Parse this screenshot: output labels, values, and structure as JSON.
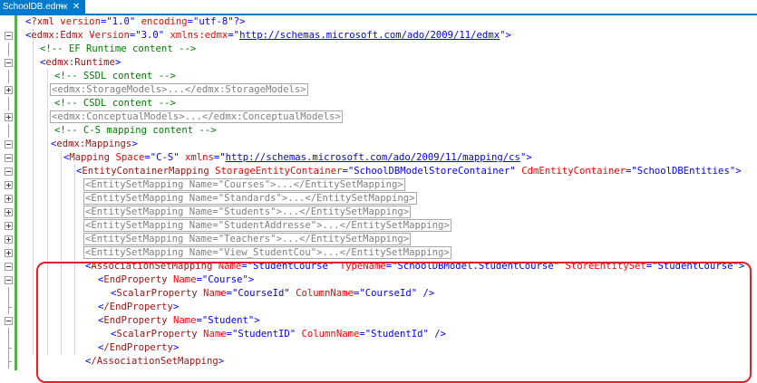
{
  "tab": {
    "label": "SchoolDB.edmx",
    "pin_icon": "pin-icon",
    "close_icon": "close-icon"
  },
  "colors": {
    "tag": "#a31515",
    "attr": "#ff0000",
    "value": "#0000ff",
    "comment": "#008000",
    "highlight": "#e0202a"
  },
  "lines": {
    "l1": {
      "xml_decl": "?xml",
      "version_attr": "version",
      "version_val": "\"1.0\"",
      "enc_attr": "encoding",
      "enc_val": "\"utf-8\""
    },
    "l2": {
      "tag": "edmx:Edmx",
      "version_attr": "Version",
      "version_val": "\"3.0\"",
      "ns_attr": "xmlns:edmx",
      "ns_url": "http://schemas.microsoft.com/ado/2009/11/edmx"
    },
    "l3": {
      "comment": "<!-- EF Runtime content -->"
    },
    "l4": {
      "tag": "edmx:Runtime"
    },
    "l5": {
      "comment": "<!-- SSDL content -->"
    },
    "l6": {
      "collapsed": "<edmx:StorageModels>...</edmx:StorageModels>"
    },
    "l7": {
      "comment": "<!-- CSDL content -->"
    },
    "l8": {
      "collapsed": "<edmx:ConceptualModels>...</edmx:ConceptualModels>"
    },
    "l9": {
      "comment": "<!-- C-S mapping content -->"
    },
    "l10": {
      "tag": "edmx:Mappings"
    },
    "l11": {
      "tag": "Mapping",
      "space_attr": "Space",
      "space_val": "\"C-S\"",
      "ns_attr": "xmlns",
      "ns_url": "http://schemas.microsoft.com/ado/2009/11/mapping/cs"
    },
    "l12": {
      "tag": "EntityContainerMapping",
      "a1": "StorageEntityContainer",
      "v1": "\"SchoolDBModelStoreContainer\"",
      "a2": "CdmEntityContainer",
      "v2": "\"SchoolDBEntities\""
    },
    "l13": {
      "collapsed": "<EntitySetMapping Name=\"Courses\">...</EntitySetMapping>"
    },
    "l14": {
      "collapsed": "<EntitySetMapping Name=\"Standards\">...</EntitySetMapping>"
    },
    "l15": {
      "collapsed": "<EntitySetMapping Name=\"Students\">...</EntitySetMapping>"
    },
    "l16": {
      "collapsed": "<EntitySetMapping Name=\"StudentAddresse\">...</EntitySetMapping>"
    },
    "l17": {
      "collapsed": "<EntitySetMapping Name=\"Teachers\">...</EntitySetMapping>"
    },
    "l18": {
      "collapsed": "<EntitySetMapping Name=\"View_StudentCou\">...</EntitySetMapping>"
    },
    "l19": {
      "tag": "AssociationSetMapping",
      "a1": "Name",
      "v1": "\"StudentCourse\"",
      "a2": "TypeName",
      "v2": "\"SchoolDBModel.StudentCourse\"",
      "a3": "StoreEntitySet",
      "v3": "\"StudentCourse\""
    },
    "l20": {
      "tag": "EndProperty",
      "a1": "Name",
      "v1": "\"Course\""
    },
    "l21": {
      "tag": "ScalarProperty",
      "a1": "Name",
      "v1": "\"CourseId\"",
      "a2": "ColumnName",
      "v2": "\"CourseId\""
    },
    "l22": {
      "tag": "/EndProperty"
    },
    "l23": {
      "tag": "EndProperty",
      "a1": "Name",
      "v1": "\"Student\""
    },
    "l24": {
      "tag": "ScalarProperty",
      "a1": "Name",
      "v1": "\"StudentID\"",
      "a2": "ColumnName",
      "v2": "\"StudentId\""
    },
    "l25": {
      "tag": "/EndProperty"
    },
    "l26": {
      "tag": "/AssociationSetMapping"
    }
  }
}
